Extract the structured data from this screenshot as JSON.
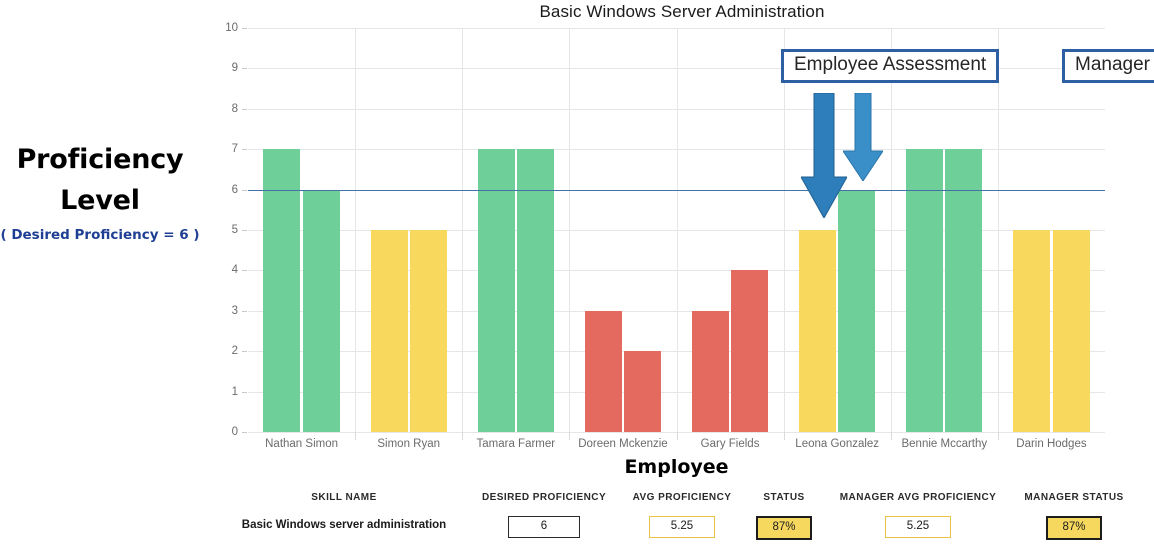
{
  "left_caption": {
    "line1": "Proficiency",
    "line2": "Level",
    "sub": "( Desired Proficiency = 6 )"
  },
  "callouts": {
    "employee": "Employee Assessment",
    "manager": "Manager Assessment"
  },
  "icons": {
    "arrow_employee": "down-arrow-icon",
    "arrow_manager": "down-arrow-icon"
  },
  "summary": {
    "headers": [
      "SKILL NAME",
      "DESIRED PROFICIENCY",
      "AVG PROFICIENCY",
      "STATUS",
      "MANAGER AVG PROFICIENCY",
      "MANAGER STATUS"
    ],
    "row": {
      "skill_name": "Basic Windows server administration",
      "desired_proficiency": "6",
      "avg_proficiency": "5.25",
      "status": "87%",
      "manager_avg_proficiency": "5.25",
      "manager_status": "87%"
    }
  },
  "colors": {
    "green": "#6ecf98",
    "yellow": "#f8d95e",
    "red": "#e4695f",
    "threshold_line": "#4472a8",
    "callout_border": "#2e5fa3",
    "arrow": "#2e7ebb",
    "grid": "#e4e6e8"
  },
  "chart_data": {
    "type": "bar",
    "title": "Basic Windows Server Administration",
    "xlabel": "Employee",
    "ylabel": "Proficiency Level",
    "ylim": [
      0,
      10
    ],
    "yticks": [
      0,
      1,
      2,
      3,
      4,
      5,
      6,
      7,
      8,
      9,
      10
    ],
    "grid": true,
    "legend_position": "none",
    "threshold": {
      "value": 6,
      "label": "Desired Proficiency = 6"
    },
    "categories": [
      "Nathan Simon",
      "Simon Ryan",
      "Tamara Farmer",
      "Doreen Mckenzie",
      "Gary Fields",
      "Leona Gonzalez",
      "Bennie Mccarthy",
      "Darin Hodges"
    ],
    "series": [
      {
        "name": "Employee Assessment",
        "values": [
          7,
          5,
          7,
          3,
          3,
          5,
          7,
          5
        ],
        "colors": [
          "#6ecf98",
          "#f8d95e",
          "#6ecf98",
          "#e4695f",
          "#e4695f",
          "#f8d95e",
          "#6ecf98",
          "#f8d95e"
        ]
      },
      {
        "name": "Manager Assessment",
        "values": [
          6,
          5,
          7,
          2,
          4,
          6,
          7,
          5
        ],
        "colors": [
          "#6ecf98",
          "#f8d95e",
          "#6ecf98",
          "#e4695f",
          "#e4695f",
          "#6ecf98",
          "#6ecf98",
          "#f8d95e"
        ]
      }
    ],
    "annotations": [
      {
        "text": "Employee Assessment",
        "points_to": "Leona Gonzalez employee bar"
      },
      {
        "text": "Manager Assessment",
        "points_to": "Leona Gonzalez manager bar"
      }
    ]
  }
}
